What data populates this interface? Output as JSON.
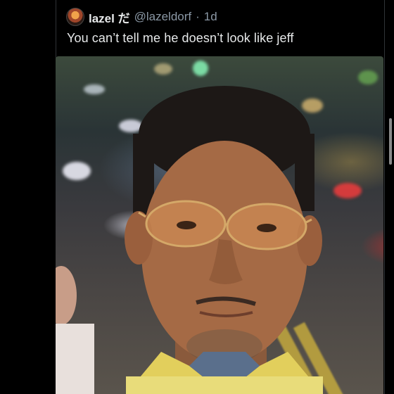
{
  "tweet": {
    "display_name": "lazel",
    "emoji_name_suffix": "だ",
    "handle": "@lazeldorf",
    "separator": "·",
    "time_ago": "1d",
    "text": "You can’t tell me he doesn’t look like jeff"
  },
  "colors": {
    "background": "#000000",
    "text_primary": "#e7e9ea",
    "text_secondary": "#8b98a5"
  },
  "icons": {
    "avatar": "avatar-image"
  }
}
